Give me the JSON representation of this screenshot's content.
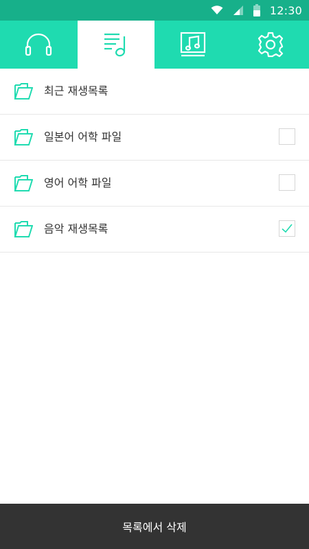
{
  "status_bar": {
    "time": "12:30",
    "icons": [
      "wifi-icon",
      "signal-icon",
      "battery-icon"
    ]
  },
  "tabs": [
    {
      "icon": "headphones-icon",
      "active": false
    },
    {
      "icon": "playlist-icon",
      "active": true
    },
    {
      "icon": "music-album-icon",
      "active": false
    },
    {
      "icon": "gear-icon",
      "active": false
    }
  ],
  "playlists": [
    {
      "name": "최근 재생목록",
      "has_checkbox": false,
      "checked": false
    },
    {
      "name": "일본어 어학 파일",
      "has_checkbox": true,
      "checked": false
    },
    {
      "name": "영어 어학 파일",
      "has_checkbox": true,
      "checked": false
    },
    {
      "name": "음악 재생목록",
      "has_checkbox": true,
      "checked": true
    }
  ],
  "bottom_action": {
    "label": "목록에서 삭제"
  },
  "colors": {
    "accent": "#1fdbb0",
    "status_bar": "#17b08a",
    "bottom_bar": "#333333"
  }
}
